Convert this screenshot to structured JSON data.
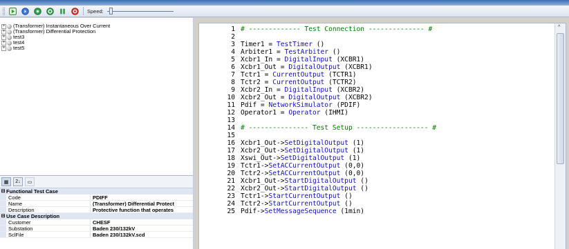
{
  "toolbar": {
    "speed_label": "Speed:",
    "buttons": [
      {
        "name": "run-button",
        "icon": "play-icon"
      },
      {
        "name": "step-button",
        "icon": "step-icon"
      },
      {
        "name": "record-button",
        "icon": "record-icon"
      },
      {
        "name": "loop-button",
        "icon": "loop-icon"
      },
      {
        "name": "pause-button",
        "icon": "pause-icon"
      },
      {
        "name": "stop-button",
        "icon": "stop-icon"
      }
    ],
    "speed_value": 0.03
  },
  "tree": {
    "items": [
      {
        "expander": "+",
        "label": "(Transformer) Instantaneous Over Current"
      },
      {
        "expander": "+",
        "label": "(Transformer) Differential Protection"
      },
      {
        "expander": "+",
        "label": "test3"
      },
      {
        "expander": "+",
        "label": "test4"
      },
      {
        "expander": "+",
        "label": "test5"
      }
    ]
  },
  "properties": {
    "toolbar": {
      "categorized": "▦",
      "alphabetical": "2↓",
      "pages": "▭"
    },
    "categories": [
      {
        "toggle": "⊟",
        "name": "Functional Test Case",
        "rows": [
          {
            "name": "Code",
            "value": "PDIFF"
          },
          {
            "name": "Name",
            "value": "(Transformer) Differential Protect"
          },
          {
            "name": "Description",
            "value": "Protective function that operates"
          }
        ]
      },
      {
        "toggle": "⊟",
        "name": "Use Case Description",
        "rows": [
          {
            "name": "Customer",
            "value": "CHESF"
          },
          {
            "name": "Substation",
            "value": "Baden 230/132kV"
          },
          {
            "name": "SclFile",
            "value": "Baden 230/132kV.scd"
          }
        ]
      }
    ]
  },
  "editor": {
    "lines": [
      {
        "n": "1",
        "parts": [
          {
            "c": "t-comment",
            "t": "# ------------- Test Connection -------------- #"
          }
        ]
      },
      {
        "n": "2",
        "parts": []
      },
      {
        "n": "3",
        "parts": [
          {
            "c": "t-plain",
            "t": "Timer1 = "
          },
          {
            "c": "t-cls",
            "t": "TestTimer"
          },
          {
            "c": "t-plain",
            "t": " ()"
          }
        ]
      },
      {
        "n": "4",
        "parts": [
          {
            "c": "t-plain",
            "t": "Arbiter1 = "
          },
          {
            "c": "t-cls",
            "t": "TestArbiter"
          },
          {
            "c": "t-plain",
            "t": " ()"
          }
        ]
      },
      {
        "n": "5",
        "parts": [
          {
            "c": "t-plain",
            "t": "Xcbr1_In = "
          },
          {
            "c": "t-cls",
            "t": "DigitalInput"
          },
          {
            "c": "t-plain",
            "t": " (XCBR1)"
          }
        ]
      },
      {
        "n": "6",
        "parts": [
          {
            "c": "t-plain",
            "t": "Xcbr1_Out = "
          },
          {
            "c": "t-cls",
            "t": "DigitalOutput"
          },
          {
            "c": "t-plain",
            "t": " (XCBR1)"
          }
        ]
      },
      {
        "n": "7",
        "parts": [
          {
            "c": "t-plain",
            "t": "Tctr1 = "
          },
          {
            "c": "t-cls",
            "t": "CurrentOutput"
          },
          {
            "c": "t-plain",
            "t": " (TCTR1)"
          }
        ]
      },
      {
        "n": "8",
        "parts": [
          {
            "c": "t-plain",
            "t": "Tctr2 = "
          },
          {
            "c": "t-cls",
            "t": "CurrentOutput"
          },
          {
            "c": "t-plain",
            "t": " (TCTR2)"
          }
        ]
      },
      {
        "n": "9",
        "parts": [
          {
            "c": "t-plain",
            "t": "Xcbr2_In = "
          },
          {
            "c": "t-cls",
            "t": "DigitalInput"
          },
          {
            "c": "t-plain",
            "t": " (XCBR2)"
          }
        ]
      },
      {
        "n": "10",
        "parts": [
          {
            "c": "t-plain",
            "t": "Xcbr2_Out = "
          },
          {
            "c": "t-cls",
            "t": "DigitalOutput"
          },
          {
            "c": "t-plain",
            "t": " (XCBR2)"
          }
        ]
      },
      {
        "n": "11",
        "parts": [
          {
            "c": "t-plain",
            "t": "Pdif = "
          },
          {
            "c": "t-cls",
            "t": "NetworkSimulator"
          },
          {
            "c": "t-plain",
            "t": " (PDIF)"
          }
        ]
      },
      {
        "n": "12",
        "parts": [
          {
            "c": "t-plain",
            "t": "Operator1 = "
          },
          {
            "c": "t-cls",
            "t": "Operator"
          },
          {
            "c": "t-plain",
            "t": " (IHMI)"
          }
        ]
      },
      {
        "n": "13",
        "parts": []
      },
      {
        "n": "14",
        "parts": [
          {
            "c": "t-comment",
            "t": "# --------------- Test Setup ------------------ #"
          }
        ]
      },
      {
        "n": "15",
        "parts": []
      },
      {
        "n": "16",
        "parts": [
          {
            "c": "t-plain",
            "t": "Xcbr1_Out->"
          },
          {
            "c": "t-cls",
            "t": "SetDigitalOutput"
          },
          {
            "c": "t-plain",
            "t": " (1)"
          }
        ]
      },
      {
        "n": "17",
        "parts": [
          {
            "c": "t-plain",
            "t": "Xcbr2_Out->"
          },
          {
            "c": "t-cls",
            "t": "SetDigitalOutput"
          },
          {
            "c": "t-plain",
            "t": " (1)"
          }
        ]
      },
      {
        "n": "18",
        "parts": [
          {
            "c": "t-plain",
            "t": "Xswi_Out->"
          },
          {
            "c": "t-cls",
            "t": "SetDigitalOutput"
          },
          {
            "c": "t-plain",
            "t": " (1)"
          }
        ]
      },
      {
        "n": "19",
        "parts": [
          {
            "c": "t-plain",
            "t": "Tctr1->"
          },
          {
            "c": "t-cls",
            "t": "SetACCurrentOutput"
          },
          {
            "c": "t-plain",
            "t": " (0,0)"
          }
        ]
      },
      {
        "n": "20",
        "parts": [
          {
            "c": "t-plain",
            "t": "Tctr2->"
          },
          {
            "c": "t-cls",
            "t": "SetACCurrentOutput"
          },
          {
            "c": "t-plain",
            "t": " (0,0)"
          }
        ]
      },
      {
        "n": "21",
        "parts": [
          {
            "c": "t-plain",
            "t": "Xcbr1_Out->"
          },
          {
            "c": "t-cls",
            "t": "StartDigitalOutput"
          },
          {
            "c": "t-plain",
            "t": " ()"
          }
        ]
      },
      {
        "n": "22",
        "parts": [
          {
            "c": "t-plain",
            "t": "Xcbr2_Out->"
          },
          {
            "c": "t-cls",
            "t": "StartDigitalOutput"
          },
          {
            "c": "t-plain",
            "t": " ()"
          }
        ]
      },
      {
        "n": "23",
        "parts": [
          {
            "c": "t-plain",
            "t": "Tctr1->"
          },
          {
            "c": "t-cls",
            "t": "StartCurrentOutput"
          },
          {
            "c": "t-plain",
            "t": " ()"
          }
        ]
      },
      {
        "n": "24",
        "parts": [
          {
            "c": "t-plain",
            "t": "Tctr2->"
          },
          {
            "c": "t-cls",
            "t": "StartCurrentOutput"
          },
          {
            "c": "t-plain",
            "t": " ()"
          }
        ]
      },
      {
        "n": "25",
        "parts": [
          {
            "c": "t-plain",
            "t": "Pdif->"
          },
          {
            "c": "t-cls",
            "t": "SetMessageSequence"
          },
          {
            "c": "t-plain",
            "t": " (1min)"
          }
        ]
      }
    ],
    "scroll_up": "^"
  },
  "colors": {
    "comment": "#008000",
    "identifier": "#1010c0",
    "titlebar": "#3b6fb0"
  }
}
